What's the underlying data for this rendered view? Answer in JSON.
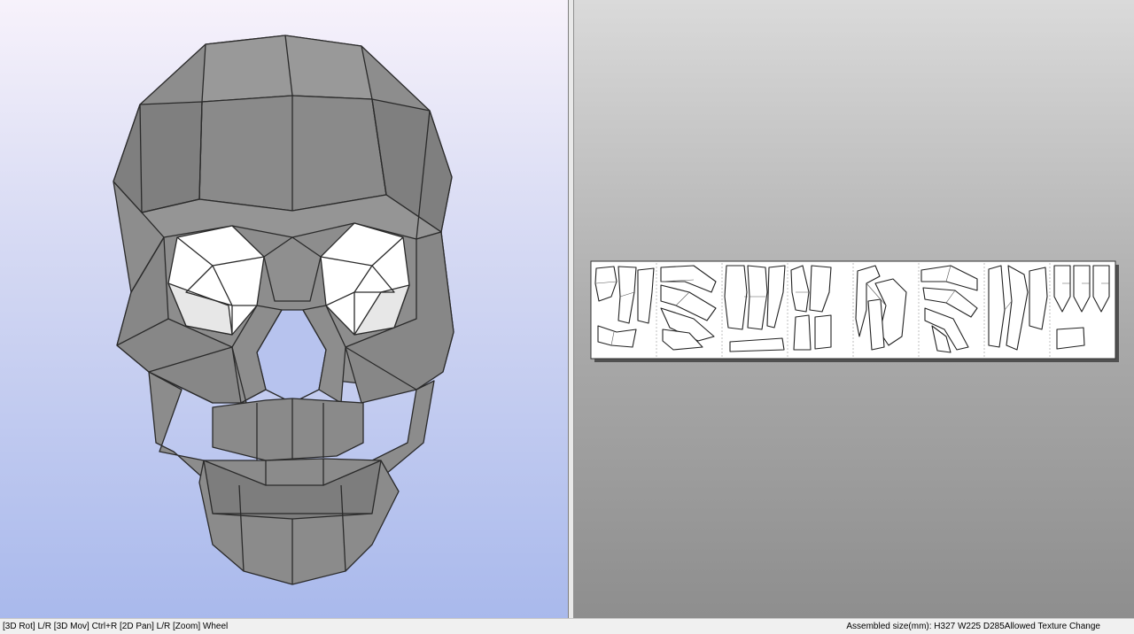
{
  "status_bar": {
    "controls_hint": "[3D Rot] L/R [3D Mov] Ctrl+R [2D Pan] L/R [Zoom] Wheel",
    "assembled_size": "Assembled size(mm): H327 W225 D285Allowed Texture Change"
  },
  "view3d": {
    "background_top": "#f7f2fb",
    "background_bottom": "#a9b9ec",
    "model_color": "#8a8a8a"
  },
  "view2d": {
    "background_top": "#dadada",
    "background_bottom": "#8e8e8e",
    "page_count": 8
  }
}
